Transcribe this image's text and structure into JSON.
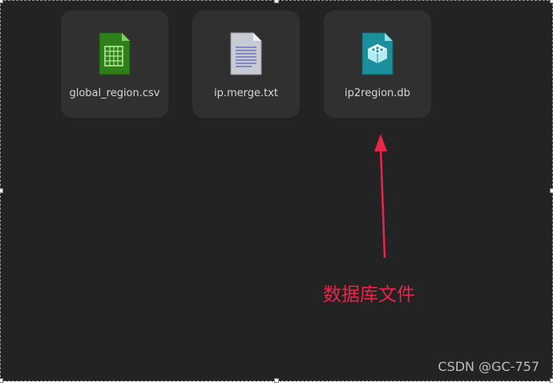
{
  "files": [
    {
      "name": "global_region.csv",
      "icon": "csv-spreadsheet-icon",
      "color": "#2f8a1a"
    },
    {
      "name": "ip.merge.txt",
      "icon": "text-document-icon",
      "color": "#c9cbd6"
    },
    {
      "name": "ip2region.db",
      "icon": "database-file-icon",
      "color": "#1e9aa8"
    }
  ],
  "annotation": {
    "text": "数据库文件",
    "color": "#e8264a"
  },
  "watermark": "CSDN @GC-757"
}
